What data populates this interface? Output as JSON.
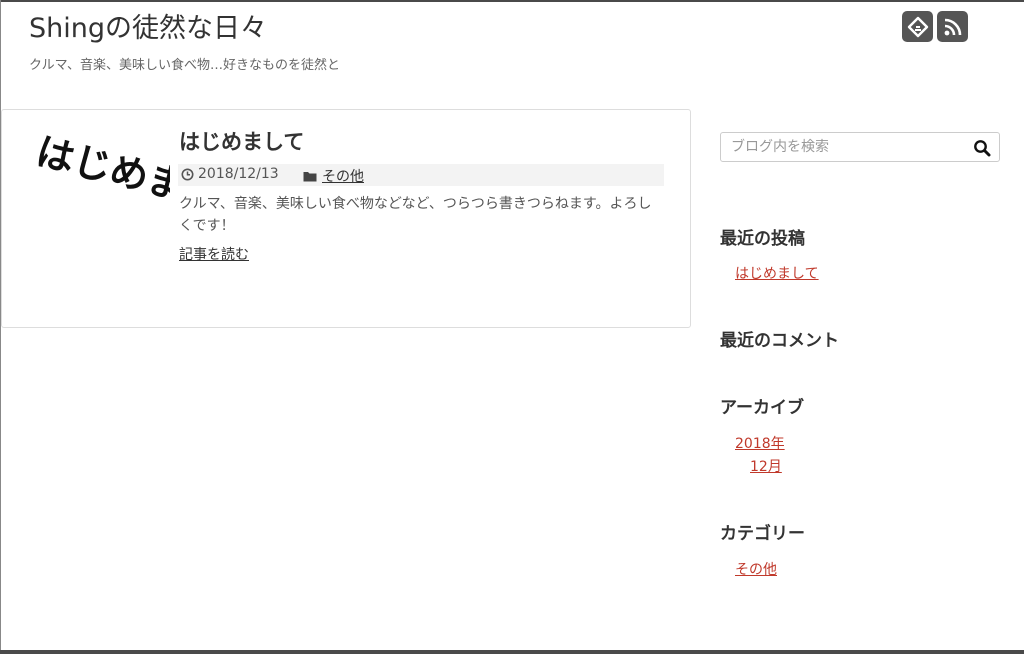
{
  "header": {
    "site_title": "Shingの徒然な日々",
    "site_description": "クルマ、音楽、美味しい食べ物…好きなものを徒然と",
    "social_icons": [
      "feedly-icon",
      "rss-icon"
    ]
  },
  "post": {
    "title": "はじめまして",
    "thumbnail_text": "はじめまして",
    "date": "2018/12/13",
    "category": "その他",
    "excerpt": "クルマ、音楽、美味しい食べ物などなど、つらつら書きつらねます。よろしくです！",
    "read_more": "記事を読む",
    "icons": [
      "clock-icon",
      "folder-icon"
    ]
  },
  "sidebar": {
    "search": {
      "placeholder": "ブログ内を検索",
      "value": ""
    },
    "recent_posts": {
      "title": "最近の投稿",
      "items": [
        "はじめまして"
      ]
    },
    "recent_comments": {
      "title": "最近のコメント"
    },
    "archives": {
      "title": "アーカイブ",
      "year": "2018年",
      "month": "12月"
    },
    "categories": {
      "title": "カテゴリー",
      "items": [
        "その他"
      ]
    }
  },
  "colors": {
    "link": "#c0392b",
    "text": "#333333",
    "icon_background": "#555555",
    "meta_bar": "#f3f3f3"
  }
}
